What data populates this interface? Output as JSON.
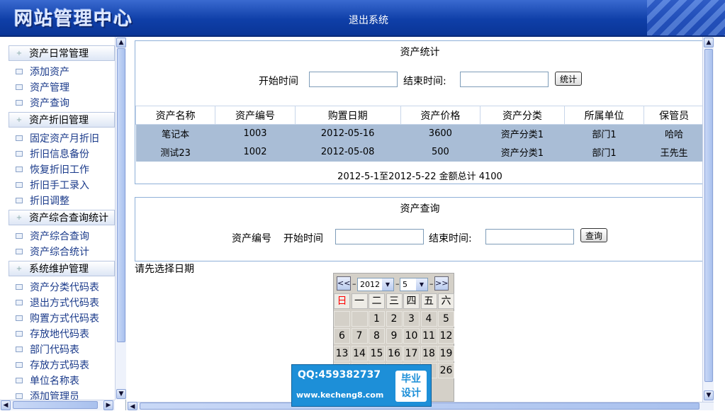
{
  "header": {
    "logo": "网站管理中心",
    "logout": "退出系统"
  },
  "sidebar": {
    "groups": [
      {
        "label": "资产日常管理",
        "items": [
          "添加资产",
          "资产管理",
          "资产查询"
        ]
      },
      {
        "label": "资产折旧管理",
        "items": [
          "固定资产月折旧",
          "折旧信息备份",
          "恢复折旧工作",
          "折旧手工录入",
          "折旧调整"
        ]
      },
      {
        "label": "资产综合查询统计",
        "items": [
          "资产综合查询",
          "资产综合统计"
        ]
      },
      {
        "label": "系统维护管理",
        "items": [
          "资产分类代码表",
          "退出方式代码表",
          "购置方式代码表",
          "存放地代码表",
          "部门代码表",
          "存放方式码表",
          "单位名称表",
          "添加管理员"
        ]
      }
    ]
  },
  "stats": {
    "title": "资产统计",
    "start_label": "开始时间",
    "end_label": "结束时间:",
    "start_value": "",
    "end_value": "",
    "button": "统计",
    "columns": [
      "资产名称",
      "资产编号",
      "购置日期",
      "资产价格",
      "资产分类",
      "所属单位",
      "保管员"
    ],
    "rows": [
      [
        "笔记本",
        "1003",
        "2012-05-16",
        "3600",
        "资产分类1",
        "部门1",
        "哈哈"
      ],
      [
        "测试23",
        "1002",
        "2012-05-08",
        "500",
        "资产分类1",
        "部门1",
        "王先生"
      ]
    ],
    "summary": "2012-5-1至2012-5-22 金额总计 4100"
  },
  "query": {
    "title": "资产查询",
    "code_label": "资产编号",
    "start_label": "开始时间",
    "end_label": "结束时间:",
    "start_value": "",
    "end_value": "",
    "button": "查询"
  },
  "prompt": "请先选择日期",
  "calendar": {
    "prev": "<<",
    "next": ">>",
    "year": "2012",
    "month": "5",
    "weekdays": [
      "日",
      "一",
      "二",
      "三",
      "四",
      "五",
      "六"
    ],
    "days": [
      [
        null,
        null,
        "1",
        "2",
        "3",
        "4",
        "5"
      ],
      [
        "6",
        "7",
        "8",
        "9",
        "10",
        "11",
        "12"
      ],
      [
        "13",
        "14",
        "15",
        "16",
        "17",
        "18",
        "19"
      ],
      [
        null,
        null,
        null,
        null,
        null,
        null,
        "26"
      ]
    ],
    "sunday_color": "#ff0000"
  },
  "watermark": {
    "qq": "QQ:459382737",
    "url": "www.kecheng8.com",
    "badge": [
      "毕业",
      "设计"
    ]
  }
}
